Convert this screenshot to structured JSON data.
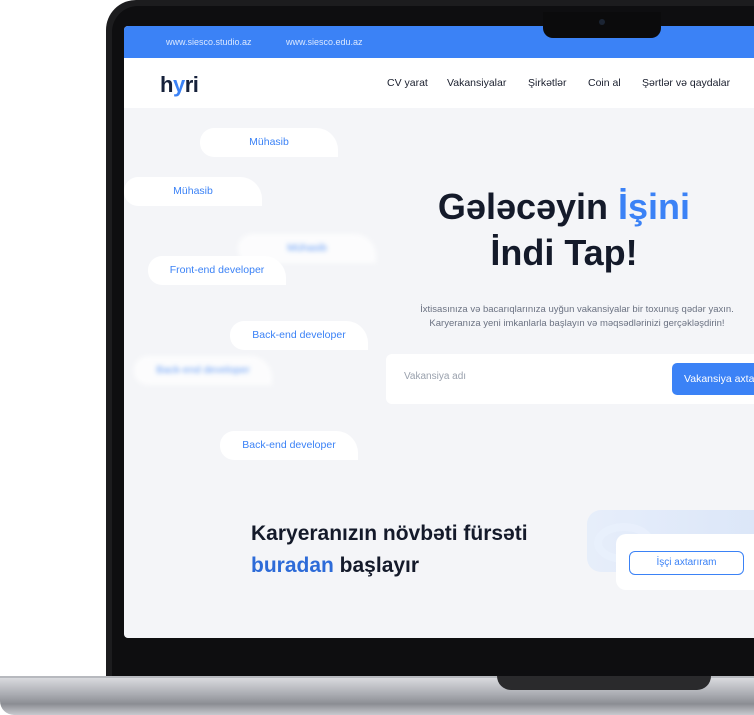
{
  "top_links": [
    "www.siesco.studio.az",
    "www.siesco.edu.az"
  ],
  "logo": {
    "part1": "h",
    "part2": "y",
    "part3": "ri"
  },
  "nav": [
    "CV yarat",
    "Vakansiyalar",
    "Şirkətlər",
    "Coin al",
    "Şərtlər və qaydalar"
  ],
  "hero": {
    "title_part1": "Gələcəyin ",
    "title_accent": "İşini",
    "title_line2": "İndi Tap!",
    "subtitle_line1": "İxtisasınıza və bacarıqlarınıza uyğun vakansiyalar bir toxunuş qədər yaxın.",
    "subtitle_line2": "Karyeranıza yeni imkanlarla başlayın və məqsədlərinizi gerçəkləşdirin!"
  },
  "search": {
    "placeholder": "Vakansiya adı",
    "button_label": "Vakansiya axtar"
  },
  "pills": [
    "Mühasib",
    "Mühasib",
    "Mühasib",
    "Front-end developer",
    "Back-end developer",
    "Back-end developer",
    "Back-end developer"
  ],
  "bottom": {
    "title_line1": "Karyeranızın növbəti fürsəti",
    "title_accent": "buradan",
    "title_rest": " başlayır",
    "employer_button": "İşçi axtarıram"
  },
  "colors": {
    "accent": "#3b82f6",
    "background": "#f4f5f8",
    "dark_text": "#141a2a"
  }
}
